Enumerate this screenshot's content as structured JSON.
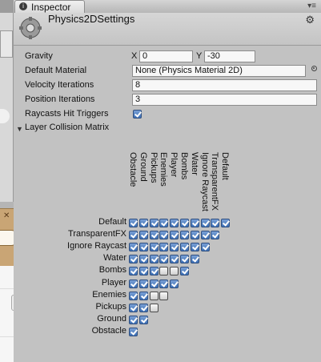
{
  "inspector": {
    "tab_label": "Inspector",
    "menu_icon": "dropdown-lines-icon",
    "asset_title": "Physics2DSettings",
    "asset_icon": "settings-gear-icon",
    "settings_icon": "gear-menu-icon"
  },
  "settings": {
    "gravity": {
      "label": "Gravity",
      "x_label": "X",
      "x_value": "0",
      "y_label": "Y",
      "y_value": "-30"
    },
    "default_material": {
      "label": "Default Material",
      "value": "None (Physics Material 2D)"
    },
    "velocity_iterations": {
      "label": "Velocity Iterations",
      "value": "8"
    },
    "position_iterations": {
      "label": "Position Iterations",
      "value": "3"
    },
    "raycasts_hit_triggers": {
      "label": "Raycasts Hit Triggers",
      "checked": true
    }
  },
  "matrix": {
    "label": "Layer Collision Matrix",
    "columns": [
      "Obstacle",
      "Ground",
      "Pickups",
      "Enemies",
      "Player",
      "Bombs",
      "Water",
      "Ignore Raycast",
      "TransparentFX",
      "Default"
    ],
    "rows": [
      {
        "label": "Default",
        "checks": [
          true,
          true,
          true,
          true,
          true,
          true,
          true,
          true,
          true,
          true
        ]
      },
      {
        "label": "TransparentFX",
        "checks": [
          true,
          true,
          true,
          true,
          true,
          true,
          true,
          true,
          true
        ]
      },
      {
        "label": "Ignore Raycast",
        "checks": [
          true,
          true,
          true,
          true,
          true,
          true,
          true,
          true
        ]
      },
      {
        "label": "Water",
        "checks": [
          true,
          true,
          true,
          true,
          true,
          true,
          true
        ]
      },
      {
        "label": "Bombs",
        "checks": [
          true,
          true,
          true,
          false,
          false,
          true
        ]
      },
      {
        "label": "Player",
        "checks": [
          true,
          true,
          true,
          true,
          true
        ]
      },
      {
        "label": "Enemies",
        "checks": [
          true,
          true,
          false,
          false
        ]
      },
      {
        "label": "Pickups",
        "checks": [
          true,
          true,
          false
        ]
      },
      {
        "label": "Ground",
        "checks": [
          true,
          true
        ]
      },
      {
        "label": "Obstacle",
        "checks": [
          true
        ]
      }
    ]
  },
  "colors": {
    "panel_bg": "#c2c2c2",
    "checkbox_on": "#3c6fb5",
    "field_bg": "#f7f7f7"
  }
}
